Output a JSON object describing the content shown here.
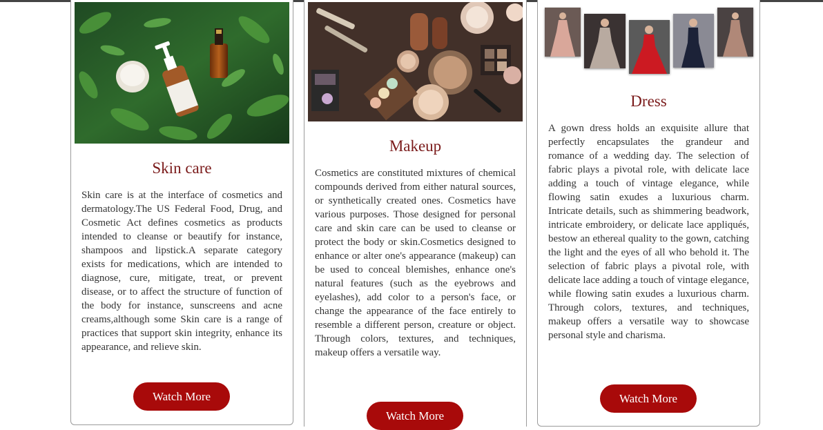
{
  "cards": [
    {
      "title": "Skin care",
      "text": "Skin care is at the interface of cosmetics and dermatology.The US Federal Food, Drug, and Cosmetic Act defines cosmetics as products intended to cleanse or beautify for instance, shampoos and lipstick.A separate category exists for medications, which are intended to diagnose, cure, mitigate, treat, or prevent disease, or to affect the structure of function of the body for instance, sunscreens and acne creams,although some Skin care is a range of practices that support skin integrity, enhance its appearance, and relieve skin.",
      "button_label": "Watch More"
    },
    {
      "title": "Makeup",
      "text": "Cosmetics are constituted mixtures of chemical compounds derived from either natural sources, or synthetically created ones. Cosmetics have various purposes. Those designed for personal care and skin care can be used to cleanse or protect the body or skin.Cosmetics designed to enhance or alter one's appearance (makeup) can be used to conceal blemishes, enhance one's natural features (such as the eyebrows and eyelashes), add color to a person's face, or change the appearance of the face entirely to resemble a different person, creature or object. Through colors, textures, and techniques, makeup offers a versatile way.",
      "button_label": "Watch More"
    },
    {
      "title": "Dress",
      "text": "A gown dress holds an exquisite allure that perfectly encapsulates the grandeur and romance of a wedding day. The selection of fabric plays a pivotal role, with delicate lace adding a touch of vintage elegance, while flowing satin exudes a luxurious charm. Intricate details, such as shimmering beadwork, intricate embroidery, or delicate lace appliqués, bestow an ethereal quality to the gown, catching the light and the eyes of all who behold it. The selection of fabric plays a pivotal role, with delicate lace adding a touch of vintage elegance, while flowing satin exudes a luxurious charm. Through colors, textures, and techniques, makeup offers a versatile way to showcase personal style and charisma.",
      "button_label": "Watch More"
    }
  ],
  "colors": {
    "title": "#7a1a1a",
    "button": "#a80a0a",
    "text": "#333333"
  },
  "icons": {
    "skincare_image": "skincare-products-on-leaves-image",
    "makeup_image": "makeup-flatlay-image",
    "dress_image": "gown-collection-image"
  }
}
